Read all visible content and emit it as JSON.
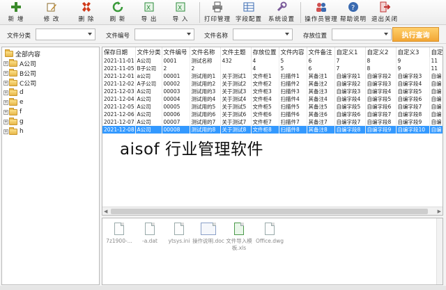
{
  "toolbar": {
    "items": [
      {
        "label": "新 增",
        "icon": "add-icon",
        "color": "#3a8a2a"
      },
      {
        "label": "修 改",
        "icon": "edit-icon",
        "color": "#c08a30"
      },
      {
        "label": "删 除",
        "icon": "delete-icon",
        "color": "#d03a1a"
      },
      {
        "label": "刷 新",
        "icon": "refresh-icon",
        "color": "#3a9a3a"
      },
      {
        "label": "导 出",
        "icon": "excel-export-icon",
        "color": "#2a8a3a"
      },
      {
        "label": "导 入",
        "icon": "excel-import-icon",
        "color": "#2a8a3a"
      },
      {
        "label": "打印管理",
        "icon": "printer-icon",
        "color": "#555555"
      },
      {
        "label": "字段配置",
        "icon": "grid-config-icon",
        "color": "#3a6ab0"
      },
      {
        "label": "系统设置",
        "icon": "settings-tools-icon",
        "color": "#7a5a9a"
      },
      {
        "label": "操作员管理",
        "icon": "users-icon",
        "color": "#3a6ab0"
      },
      {
        "label": "帮助说明",
        "icon": "help-icon",
        "color": "#3a6ab0"
      },
      {
        "label": "退出关闭",
        "icon": "exit-icon",
        "color": "#c03030"
      }
    ]
  },
  "filters": {
    "category_label": "文件分类",
    "number_label": "文件编号",
    "name_label": "文件名称",
    "location_label": "存放位置",
    "execute_label": "执行查询"
  },
  "tree": {
    "root": "全部内容",
    "nodes": [
      "A公司",
      "B公司",
      "C公司",
      "d",
      "e",
      "f",
      "g",
      "h"
    ]
  },
  "grid": {
    "columns": [
      "保存日期",
      "文件分类",
      "文件编号",
      "文件名称",
      "文件主题",
      "存放位置",
      "文件内容",
      "文件备注",
      "自定义1",
      "自定义2",
      "自定义3",
      "自定"
    ],
    "rows": [
      [
        "2021-11-01",
        "A公司",
        "0001",
        "测试名称",
        "432",
        "4",
        "5",
        "6",
        "7",
        "8",
        "9",
        "11"
      ],
      [
        "2021-11-05",
        "B子公司",
        "2",
        "2",
        "",
        "4",
        "5",
        "6",
        "7",
        "8",
        "9",
        "11"
      ],
      [
        "2021-12-01",
        "a公司",
        "00001",
        "测试用的1",
        "关于测试1",
        "文件柜1",
        "扫描件1",
        "其备注1",
        "自编字段1",
        "自编字段2",
        "自编字段3",
        "自编"
      ],
      [
        "2021-12-02",
        "A子公司",
        "00002",
        "测试用的2",
        "关于测试2",
        "文件柜2",
        "扫描件2",
        "其备注2",
        "自编字段2",
        "自编字段3",
        "自编字段4",
        "自编"
      ],
      [
        "2021-12-03",
        "A公司",
        "00003",
        "测试用的3",
        "关于测试3",
        "文件柜3",
        "扫描件3",
        "其备注3",
        "自编字段3",
        "自编字段4",
        "自编字段5",
        "自编"
      ],
      [
        "2021-12-04",
        "A公司",
        "00004",
        "测试用的4",
        "关于测试4",
        "文件柜4",
        "扫描件4",
        "其备注4",
        "自编字段4",
        "自编字段5",
        "自编字段6",
        "自编"
      ],
      [
        "2021-12-05",
        "A公司",
        "00005",
        "测试用的5",
        "关于测试5",
        "文件柜5",
        "扫描件5",
        "其备注5",
        "自编字段5",
        "自编字段6",
        "自编字段7",
        "自编"
      ],
      [
        "2021-12-06",
        "A公司",
        "00006",
        "测试用的6",
        "关于测试6",
        "文件柜6",
        "扫描件6",
        "其备注6",
        "自编字段6",
        "自编字段7",
        "自编字段8",
        "自编"
      ],
      [
        "2021-12-07",
        "A公司",
        "00007",
        "测试用的7",
        "关于测试7",
        "文件柜7",
        "扫描件7",
        "其备注7",
        "自编字段7",
        "自编字段8",
        "自编字段9",
        "自编"
      ],
      [
        "2021-12-08",
        "A公司",
        "00008",
        "测试用的8",
        "关于测试8",
        "文件柜8",
        "扫描件8",
        "其备注8",
        "自编字段8",
        "自编字段9",
        "自编字段10",
        "自编"
      ]
    ],
    "selected_row": 9
  },
  "watermark": "aisof 行业管理软件",
  "files": [
    {
      "name": "7z1900-...",
      "type": "generic"
    },
    {
      "name": "-a.dat",
      "type": "generic"
    },
    {
      "name": "ytsys.ini",
      "type": "generic"
    },
    {
      "name": "操作说明.doc",
      "type": "thumb"
    },
    {
      "name": "文件导入模板.xls",
      "type": "green"
    },
    {
      "name": "Office.dwg",
      "type": "generic"
    }
  ]
}
